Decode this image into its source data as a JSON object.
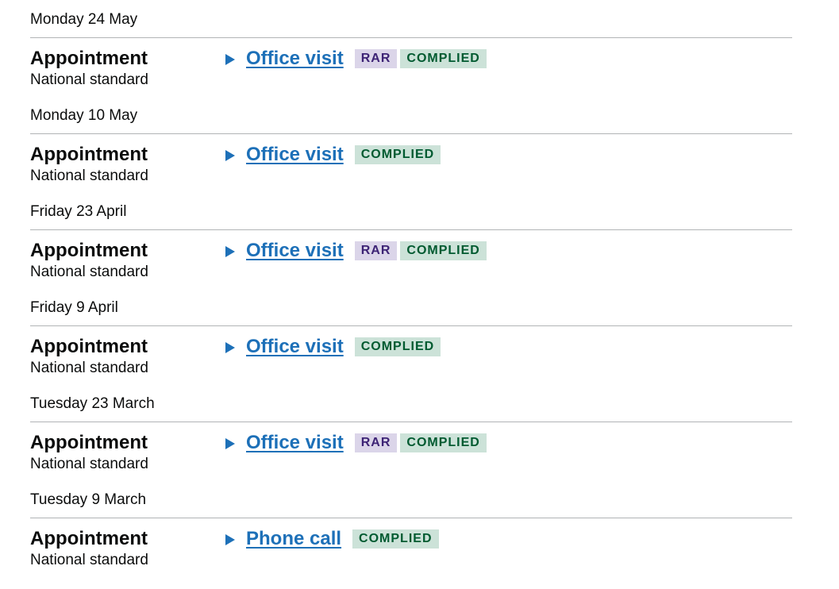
{
  "groups": [
    {
      "date": "Monday 24 May",
      "entry": {
        "title": "Appointment",
        "subtitle": "National standard",
        "link": "Office visit",
        "tags": [
          "RAR",
          "COMPLIED"
        ]
      }
    },
    {
      "date": "Monday 10 May",
      "entry": {
        "title": "Appointment",
        "subtitle": "National standard",
        "link": "Office visit",
        "tags": [
          "COMPLIED"
        ]
      }
    },
    {
      "date": "Friday 23 April",
      "entry": {
        "title": "Appointment",
        "subtitle": "National standard",
        "link": "Office visit",
        "tags": [
          "RAR",
          "COMPLIED"
        ]
      }
    },
    {
      "date": "Friday 9 April",
      "entry": {
        "title": "Appointment",
        "subtitle": "National standard",
        "link": "Office visit",
        "tags": [
          "COMPLIED"
        ]
      }
    },
    {
      "date": "Tuesday 23 March",
      "entry": {
        "title": "Appointment",
        "subtitle": "National standard",
        "link": "Office visit",
        "tags": [
          "RAR",
          "COMPLIED"
        ]
      }
    },
    {
      "date": "Tuesday 9 March",
      "entry": {
        "title": "Appointment",
        "subtitle": "National standard",
        "link": "Phone call",
        "tags": [
          "COMPLIED"
        ]
      }
    }
  ],
  "tag_colors": {
    "RAR": {
      "background": "#dbd5e9",
      "text": "#3d2375"
    },
    "COMPLIED": {
      "background": "#cce2d8",
      "text": "#005a30"
    }
  },
  "icons": {
    "toggle": "triangle-right-icon"
  }
}
